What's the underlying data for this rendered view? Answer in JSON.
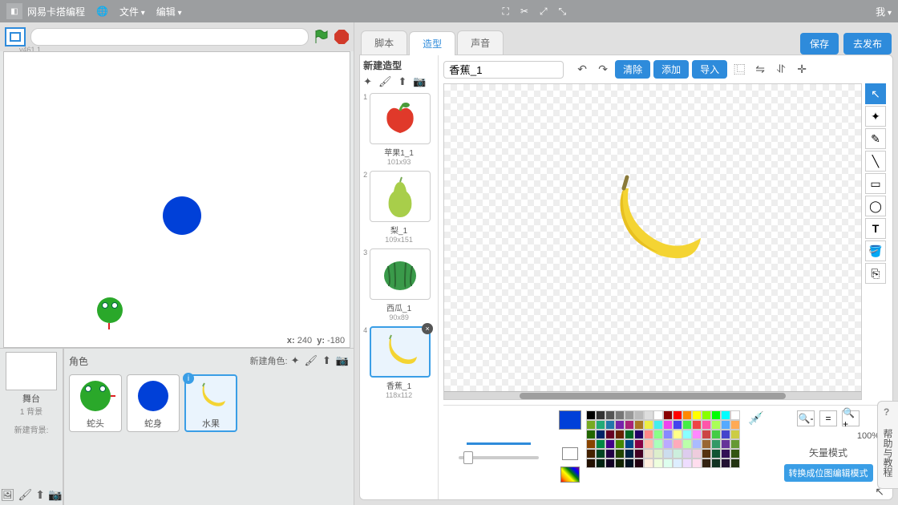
{
  "menubar": {
    "title": "网易卡搭编程",
    "globe": "🌐",
    "file": "文件",
    "edit": "编辑",
    "me": "我"
  },
  "version": "v461.1",
  "stage": {
    "coords_x_label": "x:",
    "coords_x": "240",
    "coords_y_label": "y:",
    "coords_y": "-180"
  },
  "sprite_panel": {
    "stage_label": "舞台",
    "stage_bg": "1 背景",
    "new_bg": "新建背景:",
    "sprites_title": "角色",
    "new_sprite": "新建角色:"
  },
  "sprites": [
    {
      "label": "蛇头"
    },
    {
      "label": "蛇身"
    },
    {
      "label": "水果"
    }
  ],
  "tabs": {
    "scripts": "脚本",
    "costumes": "造型",
    "sounds": "声音"
  },
  "actions": {
    "save": "保存",
    "publish": "去发布"
  },
  "costume_list": {
    "title": "新建造型",
    "items": [
      {
        "num": "1",
        "label": "苹果1_1",
        "dim": "101x93"
      },
      {
        "num": "2",
        "label": "梨_1",
        "dim": "109x151"
      },
      {
        "num": "3",
        "label": "西瓜_1",
        "dim": "90x89"
      },
      {
        "num": "4",
        "label": "香蕉_1",
        "dim": "118x112"
      }
    ]
  },
  "paint": {
    "costume_name": "香蕉_1",
    "clear": "清除",
    "add": "添加",
    "import": "导入",
    "zoom": "100%",
    "mode_title": "矢量模式",
    "mode_btn": "转换成位图编辑模式"
  },
  "colors": {
    "current": "#0040d8"
  },
  "help_tab": "帮助与教程"
}
